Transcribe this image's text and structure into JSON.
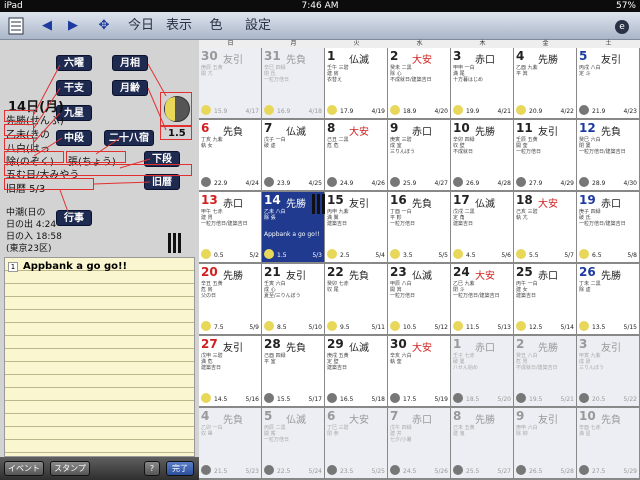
{
  "status": {
    "carrier": "iPad",
    "time": "7:46 AM",
    "battery": "57%"
  },
  "toolbar": {
    "today": "今日",
    "display": "表示",
    "color": "色",
    "settings": "設定"
  },
  "detail": {
    "date": "14日(月)",
    "senpu": "先勝",
    "senpu_reading": "(せんぷ)",
    "kanshi": "乙未",
    "kanshi_reading": "(きの",
    "kyusei": "八白",
    "kyusei_reading": "(はっ",
    "juni": "除(のぞく)",
    "shuku": "張(ちょう)",
    "event": "五む日/大みやう",
    "old": "旧暦 5/3",
    "moon_age": "1.5",
    "tide": "中潮(日の",
    "sunrise_label": "日の出",
    "sunrise": "4:24",
    "sunset_label": "日の入",
    "sunset": "18:58",
    "place": "(東京23区)",
    "buttons": {
      "rokuyo": "六曜",
      "getsuso": "月相",
      "kanshi": "干支",
      "getsurei": "月齢",
      "kyusei": "九星",
      "nijuhasshuku": "二十八宿",
      "chudan": "中段",
      "gedan": "下段",
      "kyureki": "旧暦",
      "gyoji": "行事"
    }
  },
  "memo": {
    "num": "1",
    "text": "Appbank a go go!!"
  },
  "bottom": {
    "event": "イベント",
    "stamp": "スタンプ",
    "help": "?",
    "done": "完了"
  },
  "days": [
    "日",
    "月",
    "火",
    "水",
    "木",
    "金",
    "土"
  ],
  "weeks": [
    [
      {
        "d": "30",
        "r": "友引",
        "dim": true,
        "i": "庚辰 五黄\n開 亢",
        "a": "15.9",
        "o": "4/17"
      },
      {
        "d": "31",
        "r": "先負",
        "dim": true,
        "i": "辛巳 四緑\n閉 氐\n一粒万倍日",
        "a": "16.9",
        "o": "4/18"
      },
      {
        "d": "1",
        "r": "仏滅",
        "i": "壬午 三碧\n建 房\n衣替え",
        "a": "17.9",
        "o": "4/19"
      },
      {
        "d": "2",
        "r": "大安",
        "rr": true,
        "i": "癸未 二黒\n除 心\n不成就日/建築吉日",
        "a": "18.9",
        "o": "4/20"
      },
      {
        "d": "3",
        "r": "赤口",
        "i": "甲申 一白\n満 尾\n十方暮はじめ",
        "a": "19.9",
        "o": "4/21"
      },
      {
        "d": "4",
        "r": "先勝",
        "i": "乙酉 九紫\n平 箕",
        "a": "20.9",
        "o": "4/22"
      },
      {
        "d": "5",
        "r": "友引",
        "sat": true,
        "i": "丙戌 八白\n定 斗",
        "a": "21.9",
        "o": "4/23",
        "dk": true
      }
    ],
    [
      {
        "d": "6",
        "r": "先負",
        "sun": true,
        "i": "丁亥 九紫\n執 女",
        "a": "22.9",
        "o": "4/24",
        "dk": true
      },
      {
        "d": "7",
        "r": "仏滅",
        "i": "戊子 一白\n破 虚",
        "a": "23.9",
        "o": "4/25",
        "dk": true
      },
      {
        "d": "8",
        "r": "大安",
        "rr": true,
        "i": "己丑 二黒\n危 危",
        "a": "24.9",
        "o": "4/26",
        "dk": true
      },
      {
        "d": "9",
        "r": "赤口",
        "i": "庚寅 三碧\n成 室\n三りんぼう",
        "a": "25.9",
        "o": "4/27",
        "dk": true
      },
      {
        "d": "10",
        "r": "先勝",
        "i": "辛卯 四緑\n収 壁\n不成就日",
        "a": "26.9",
        "o": "4/28",
        "dk": true
      },
      {
        "d": "11",
        "r": "友引",
        "i": "壬辰 五黄\n開 奎\n一粒万倍日",
        "a": "27.9",
        "o": "4/29",
        "dk": true
      },
      {
        "d": "12",
        "r": "先負",
        "sat": true,
        "i": "癸巳 六白\n閉 婁\n一粒万倍日/建築吉日",
        "a": "28.9",
        "o": "4/30",
        "dk": true
      }
    ],
    [
      {
        "d": "13",
        "r": "赤口",
        "sun": true,
        "i": "甲午 七赤\n建 胃\n一粒万倍日/建築吉日",
        "a": "0.5",
        "o": "5/2"
      },
      {
        "d": "14",
        "r": "先勝",
        "sel": true,
        "i": "乙未 八白\n除 張",
        "m": "Appbank a go go!!",
        "a": "1.5",
        "o": "5/3"
      },
      {
        "d": "15",
        "r": "友引",
        "i": "丙申 九紫\n満 翼\n建築吉日",
        "a": "2.5",
        "o": "5/4"
      },
      {
        "d": "16",
        "r": "先負",
        "i": "丁酉 一白\n平 軫\n一粒万倍日",
        "a": "3.5",
        "o": "5/5"
      },
      {
        "d": "17",
        "r": "仏滅",
        "i": "戊戌 二黒\n定 角\n建築吉日",
        "a": "4.5",
        "o": "5/6"
      },
      {
        "d": "18",
        "r": "大安",
        "rr": true,
        "i": "己亥 三碧\n執 亢",
        "a": "5.5",
        "o": "5/7"
      },
      {
        "d": "19",
        "r": "赤口",
        "sat": true,
        "i": "庚子 四緑\n破 氐\n一粒万倍日/建築吉日",
        "a": "6.5",
        "o": "5/8"
      }
    ],
    [
      {
        "d": "20",
        "r": "先勝",
        "sun": true,
        "i": "辛丑 五黄\n危 房\n父の日",
        "a": "7.5",
        "o": "5/9"
      },
      {
        "d": "21",
        "r": "友引",
        "i": "壬寅 六白\n成 心\n夏至/三りんぼう",
        "a": "8.5",
        "o": "5/10"
      },
      {
        "d": "22",
        "r": "先負",
        "i": "癸卯 七赤\n収 尾",
        "a": "9.5",
        "o": "5/11"
      },
      {
        "d": "23",
        "r": "仏滅",
        "i": "甲辰 八白\n開 箕\n一粒万倍日",
        "a": "10.5",
        "o": "5/12"
      },
      {
        "d": "24",
        "r": "大安",
        "rr": true,
        "i": "乙巳 九紫\n閉 斗\n一粒万倍日/建築吉日",
        "a": "11.5",
        "o": "5/13"
      },
      {
        "d": "25",
        "r": "赤口",
        "i": "丙午 一白\n建 女\n建築吉日",
        "a": "12.5",
        "o": "5/14"
      },
      {
        "d": "26",
        "r": "先勝",
        "sat": true,
        "i": "丁未 二黒\n除 虚",
        "a": "13.5",
        "o": "5/15"
      }
    ],
    [
      {
        "d": "27",
        "r": "友引",
        "sun": true,
        "i": "戊申 三碧\n満 危\n建築吉日",
        "a": "14.5",
        "o": "5/16"
      },
      {
        "d": "28",
        "r": "先負",
        "i": "己酉 四緑\n平 室",
        "a": "15.5",
        "o": "5/17",
        "dk": true
      },
      {
        "d": "29",
        "r": "仏滅",
        "i": "庚戌 五黄\n定 壁\n建築吉日",
        "a": "16.5",
        "o": "5/18",
        "dk": true
      },
      {
        "d": "30",
        "r": "大安",
        "rr": true,
        "i": "辛亥 六白\n執 奎",
        "a": "17.5",
        "o": "5/19",
        "dk": true
      },
      {
        "d": "1",
        "r": "赤口",
        "dim": true,
        "i": "壬子 七赤\n破 婁\n八せん始め",
        "a": "18.5",
        "o": "5/20",
        "dk": true
      },
      {
        "d": "2",
        "r": "先勝",
        "dim": true,
        "i": "癸丑 八白\n危 胃\n不成就日/建築吉日",
        "a": "19.5",
        "o": "5/21",
        "dk": true
      },
      {
        "d": "3",
        "r": "友引",
        "dim": true,
        "i": "甲寅 九紫\n成 昴\n三りんぼう",
        "a": "20.5",
        "o": "5/22",
        "dk": true
      }
    ],
    [
      {
        "d": "4",
        "r": "先負",
        "dim": true,
        "i": "乙卯 一白\n収 畢",
        "a": "21.5",
        "o": "5/23",
        "dk": true
      },
      {
        "d": "5",
        "r": "仏滅",
        "dim": true,
        "i": "丙辰 二黒\n開 觜\n一粒万倍日",
        "a": "22.5",
        "o": "5/24",
        "dk": true
      },
      {
        "d": "6",
        "r": "大安",
        "rr": true,
        "dim": true,
        "i": "丁巳 三碧\n閉 参",
        "a": "23.5",
        "o": "5/25",
        "dk": true
      },
      {
        "d": "7",
        "r": "赤口",
        "dim": true,
        "i": "戊午 四緑\n建 井\n七夕/小暑",
        "a": "24.5",
        "o": "5/26",
        "dk": true
      },
      {
        "d": "8",
        "r": "先勝",
        "dim": true,
        "i": "己未 五黄\n建 鬼",
        "a": "25.5",
        "o": "5/27",
        "dk": true
      },
      {
        "d": "9",
        "r": "友引",
        "dim": true,
        "i": "庚申 六白\n除 柳",
        "a": "26.5",
        "o": "5/28",
        "dk": true
      },
      {
        "d": "10",
        "r": "先負",
        "dim": true,
        "i": "辛酉 七赤\n満 星",
        "a": "27.5",
        "o": "5/29",
        "dk": true
      }
    ]
  ]
}
